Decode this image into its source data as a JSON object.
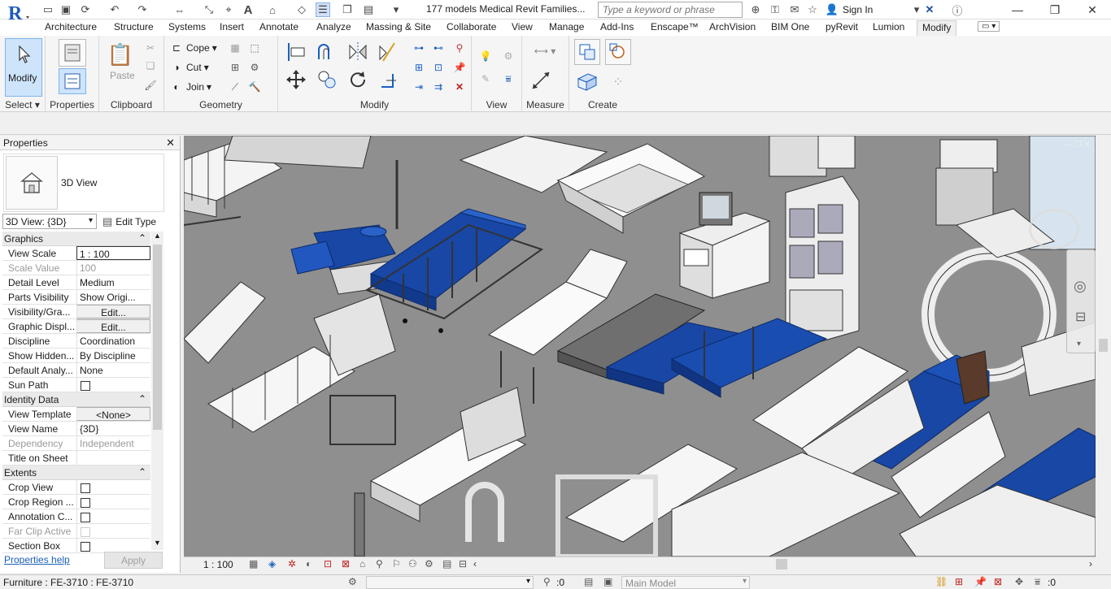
{
  "titlebar": {
    "doc_title": "177 models Medical Revit Families...",
    "search_placeholder": "Type a keyword or phrase",
    "sign_in": "Sign In"
  },
  "tabs": [
    "Architecture",
    "Structure",
    "Systems",
    "Insert",
    "Annotate",
    "Analyze",
    "Massing & Site",
    "Collaborate",
    "View",
    "Manage",
    "Add-Ins",
    "Enscape™",
    "ArchVision",
    "BIM One",
    "pyRevit",
    "Lumion",
    "Modify"
  ],
  "active_tab": "Modify",
  "ribbon": {
    "select": {
      "button": "Modify",
      "label": "Select"
    },
    "properties": {
      "label": "Properties"
    },
    "clipboard": {
      "paste": "Paste",
      "label": "Clipboard"
    },
    "geometry": {
      "cope": "Cope",
      "cut": "Cut",
      "join": "Join",
      "label": "Geometry"
    },
    "modify": {
      "label": "Modify"
    },
    "view": {
      "label": "View"
    },
    "measure": {
      "label": "Measure"
    },
    "create": {
      "label": "Create"
    }
  },
  "properties_palette": {
    "title": "Properties",
    "type_name": "3D View",
    "instance_selector": "3D View: {3D}",
    "edit_type": "Edit Type",
    "groups": {
      "graphics": "Graphics",
      "identity": "Identity Data",
      "extents": "Extents"
    },
    "rows": {
      "view_scale": {
        "name": "View Scale",
        "value": "1 : 100"
      },
      "scale_value": {
        "name": "Scale Value",
        "prefix": "1:",
        "value": "100"
      },
      "detail_level": {
        "name": "Detail Level",
        "value": "Medium"
      },
      "parts_visibility": {
        "name": "Parts Visibility",
        "value": "Show Origi..."
      },
      "visibility_graphics": {
        "name": "Visibility/Gra...",
        "value": "Edit..."
      },
      "graphic_display": {
        "name": "Graphic Displ...",
        "value": "Edit..."
      },
      "discipline": {
        "name": "Discipline",
        "value": "Coordination"
      },
      "show_hidden": {
        "name": "Show Hidden...",
        "value": "By Discipline"
      },
      "default_analysis": {
        "name": "Default Analy...",
        "value": "None"
      },
      "sun_path": {
        "name": "Sun Path",
        "value": ""
      },
      "view_template": {
        "name": "View Template",
        "value": "<None>"
      },
      "view_name": {
        "name": "View Name",
        "value": "{3D}"
      },
      "dependency": {
        "name": "Dependency",
        "value": "Independent"
      },
      "title_on_sheet": {
        "name": "Title on Sheet",
        "value": ""
      },
      "crop_view": {
        "name": "Crop View",
        "value": ""
      },
      "crop_region": {
        "name": "Crop Region ...",
        "value": ""
      },
      "annotation_crop": {
        "name": "Annotation C...",
        "value": ""
      },
      "far_clip": {
        "name": "Far Clip Active",
        "value": ""
      },
      "section_box": {
        "name": "Section Box",
        "value": ""
      }
    },
    "help_link": "Properties help",
    "apply": "Apply"
  },
  "view_control_bar": {
    "scale": "1 : 100"
  },
  "statusbar": {
    "message": "Furniture : FE-3710 : FE-3710",
    "selection_count": ":0",
    "model": "Main Model",
    "filter_count": ":0"
  },
  "colors": {
    "accent_blue": "#0a3d91",
    "viewport_bg": "#8d8d8d",
    "ribbon_bg": "#f5f5f5"
  }
}
